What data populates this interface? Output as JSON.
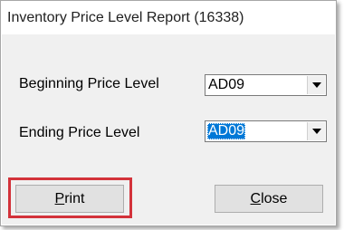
{
  "window": {
    "title": "Inventory Price Level Report (16338)"
  },
  "form": {
    "beginning": {
      "label": "Beginning Price Level",
      "value": "AD09"
    },
    "ending": {
      "label": "Ending Price Level",
      "value": "AD09"
    }
  },
  "buttons": {
    "print": {
      "mnemonic": "P",
      "rest": "rint"
    },
    "close": {
      "mnemonic": "C",
      "rest": "lose"
    }
  },
  "icons": {
    "dropdown": "chevron-down-icon"
  },
  "colors": {
    "selection": "#0078d7",
    "highlight_box": "#d3323a"
  }
}
